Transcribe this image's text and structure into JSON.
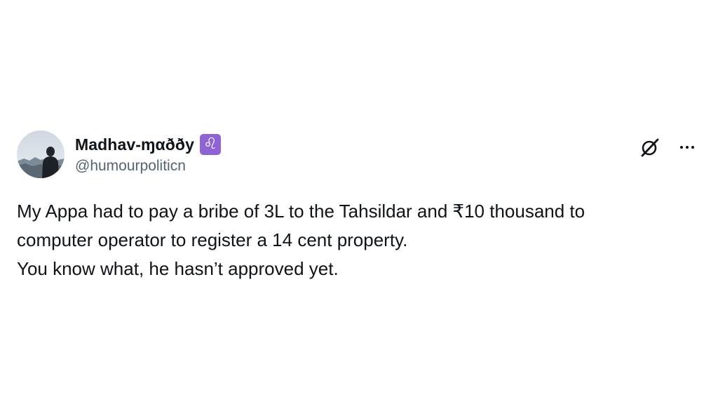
{
  "author": {
    "display_name": "Madhav-ɱαððу",
    "badge_glyph": "♌",
    "badge_icon": "leo-zodiac-icon",
    "badge_color": "#8e63d6",
    "handle": "@humourpoliticn",
    "avatar_icon": "silhouette-avatar"
  },
  "actions": {
    "grok_icon": "grok-icon",
    "more_icon": "more-options-icon"
  },
  "tweet": {
    "lines": [
      "My Appa had to pay a bribe of 3L to the Tahsildar and ₹10 thousand to",
      "computer operator to register a 14 cent property.",
      "You know what, he hasn’t approved yet."
    ]
  },
  "colors": {
    "text_primary": "#0f1419",
    "text_secondary": "#536471",
    "background": "#ffffff"
  }
}
